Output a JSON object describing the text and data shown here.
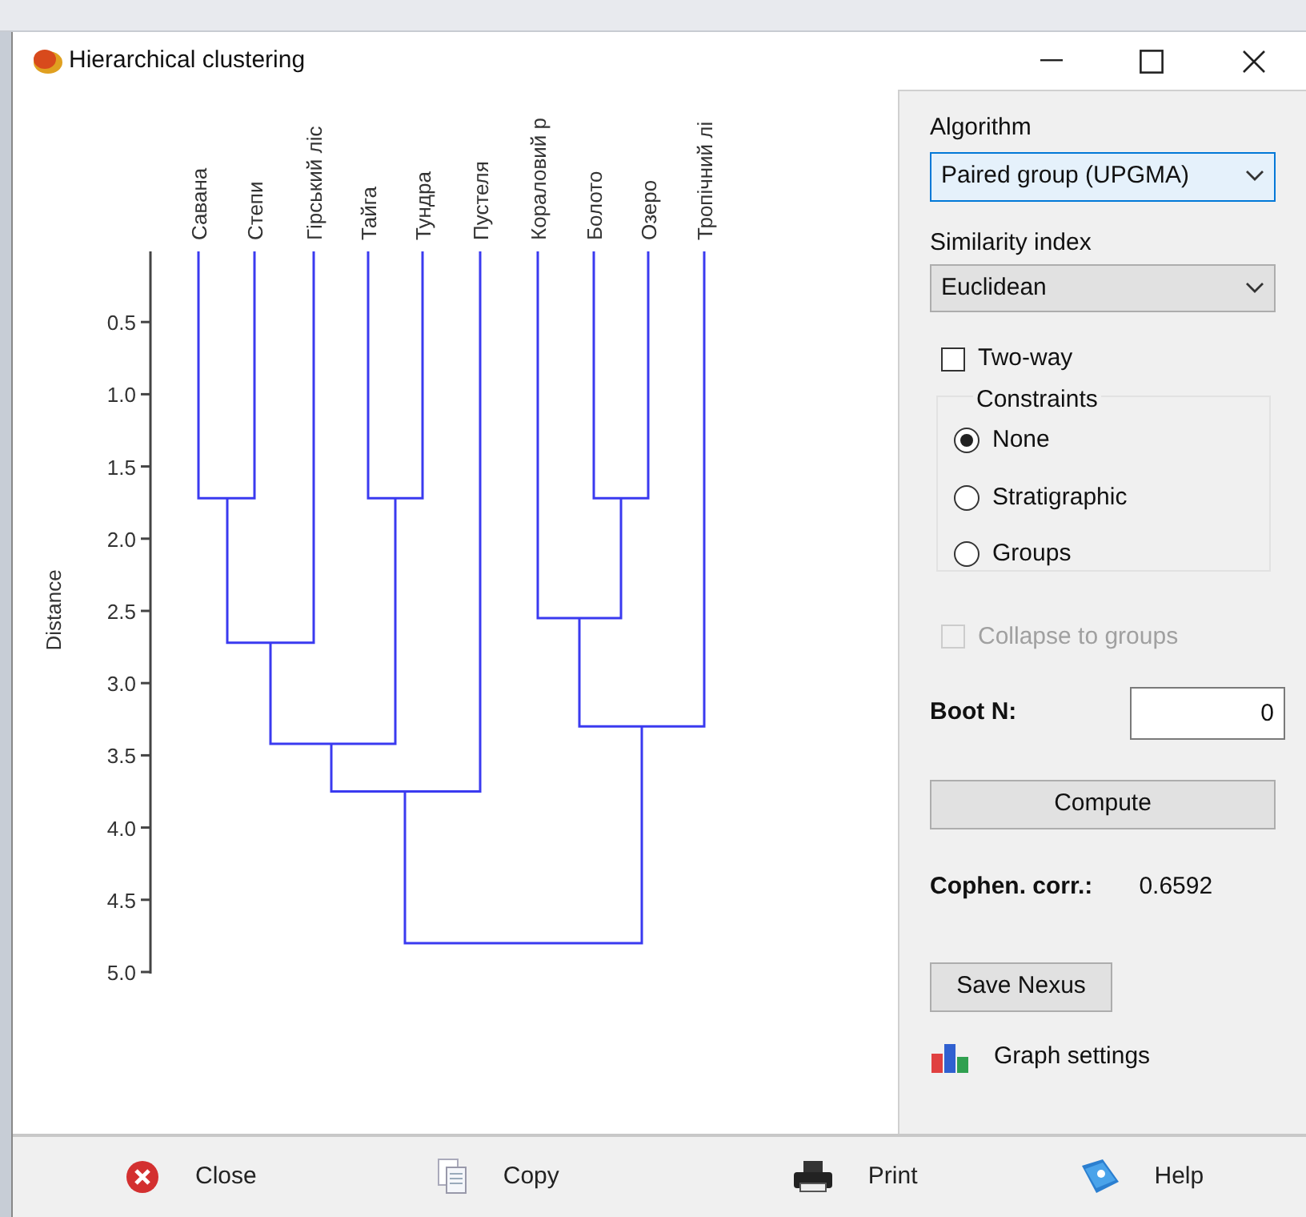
{
  "window": {
    "title": "Hierarchical clustering"
  },
  "dendrogram": {
    "leaves": [
      "Савана",
      "Степи",
      "Гірський ліс",
      "Тайга",
      "Тундра",
      "Пустеля",
      "Кораловий р",
      "Болото",
      "Озеро",
      "Тропічний лі"
    ],
    "y_axis": {
      "label": "Distance",
      "ticks": [
        "0.5",
        "1.0",
        "1.5",
        "2.0",
        "2.5",
        "3.0",
        "3.5",
        "4.0",
        "4.5",
        "5.0"
      ]
    }
  },
  "panel": {
    "algorithm": {
      "label": "Algorithm",
      "value": "Paired group (UPGMA)"
    },
    "similarity": {
      "label": "Similarity index",
      "value": "Euclidean"
    },
    "two_way": {
      "label": "Two-way",
      "checked": false
    },
    "constraints": {
      "title": "Constraints",
      "options": [
        {
          "label": "None",
          "selected": true
        },
        {
          "label": "Stratigraphic",
          "selected": false
        },
        {
          "label": "Groups",
          "selected": false
        }
      ]
    },
    "collapse": {
      "label": "Collapse to groups",
      "checked": false,
      "disabled": true
    },
    "boot_n": {
      "label": "Boot N:",
      "value": "0"
    },
    "compute": "Compute",
    "cophen": {
      "label": "Cophen. corr.:",
      "value": "0.6592"
    },
    "save_nexus": "Save Nexus",
    "graph_settings": "Graph settings"
  },
  "toolbar": [
    {
      "kind": "close",
      "label": "Close"
    },
    {
      "kind": "copy",
      "label": "Copy"
    },
    {
      "kind": "print",
      "label": "Print"
    },
    {
      "kind": "help",
      "label": "Help"
    }
  ]
}
